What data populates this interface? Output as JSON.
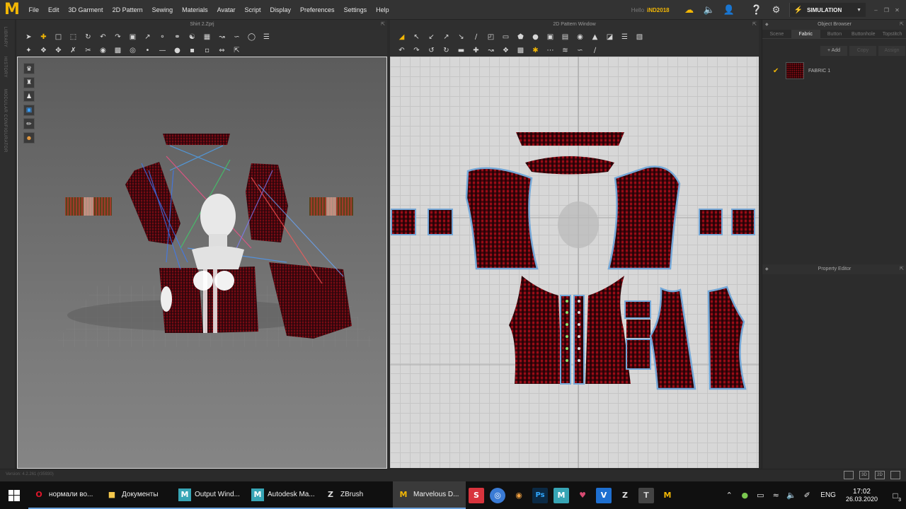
{
  "app": {
    "logo": "M",
    "menu": [
      "File",
      "Edit",
      "3D Garment",
      "2D Pattern",
      "Sewing",
      "Materials",
      "Avatar",
      "Script",
      "Display",
      "Preferences",
      "Settings",
      "Help"
    ],
    "hello_label": "Hello",
    "username": "iND2018",
    "simulation_label": "SIMULATION",
    "accent_color": "#f2b705"
  },
  "left_tabs": [
    "LIBRARY",
    "HISTORY",
    "MODULAR CONFIGURATOR"
  ],
  "viewport3d": {
    "title": "Shirt 2.Zprj"
  },
  "viewport2d": {
    "title": "2D Pattern Window"
  },
  "toolbar3d": {
    "row1": [
      "select-icon",
      "move-icon",
      "box-select-icon",
      "transform-icon",
      "rotate-icon",
      "fold-icon",
      "pin-icon",
      "pin-box-icon",
      "measure-icon",
      "tack-icon",
      "strap-icon",
      "garment-icon",
      "fit-icon",
      "tape-icon",
      "edit-curve-icon",
      "lasso-icon",
      "arrange-icon"
    ],
    "row2": [
      "avatar-icon",
      "pleat-icon",
      "zip-icon",
      "puckering-icon",
      "cut-icon",
      "button-icon",
      "graphic-icon",
      "target-icon",
      "point-icon",
      "line-icon",
      "record-icon",
      "texture-icon",
      "edit-texture-icon",
      "ruler-icon",
      "resize-icon"
    ]
  },
  "toolbar2d": {
    "row1": [
      "edit-pattern-icon",
      "edit-point-icon",
      "edit-curve-point-icon",
      "curvature-icon",
      "add-point-icon",
      "slash-icon",
      "fold-arrangement-icon",
      "rectangle-icon",
      "polygon-icon",
      "circle-icon",
      "internal-rect-icon",
      "internal-polygon-icon",
      "internal-circle-icon",
      "dart-icon",
      "trace-icon",
      "pleats-icon",
      "steps-icon"
    ],
    "row2": [
      "segment-sew-icon",
      "free-sew-icon",
      "multi-sew-icon",
      "check-sew-icon",
      "tape-2d-icon",
      "topstitch-icon",
      "fold-2d-icon",
      "buttonhole-2d-icon",
      "texture-2d-icon",
      "graphic-2d-icon",
      "pin-2d-icon",
      "gather-icon",
      "stretch-icon",
      "overlap-icon"
    ]
  },
  "viewport_tools": [
    "shirt-icon",
    "jacket-icon",
    "avatar-front-icon",
    "fabric-icon",
    "eraser-icon",
    "skin-icon"
  ],
  "object_browser": {
    "title": "Object Browser",
    "tabs": [
      "Scene",
      "Fabric",
      "Button",
      "Buttonhole",
      "Topstitch"
    ],
    "active_tab": "Fabric",
    "actions": [
      "+ Add",
      "Copy",
      "Assign"
    ],
    "fabrics": [
      {
        "name": "FABRIC 1",
        "color": "#8a0c15",
        "checked": true
      }
    ]
  },
  "property_editor": {
    "title": "Property Editor"
  },
  "status": {
    "version": "Version: 4.2.261 (r35930)"
  },
  "taskbar": {
    "tasks": [
      {
        "label": "нормали во...",
        "icon": "opera-icon",
        "color": "#e0162b"
      },
      {
        "label": "Документы",
        "icon": "folder-icon",
        "color": "#f5c84c"
      },
      {
        "label": "Output Wind...",
        "icon": "maya-icon",
        "color": "#37a5b5"
      },
      {
        "label": "Autodesk Ma...",
        "icon": "maya-icon",
        "color": "#37a5b5"
      },
      {
        "label": "ZBrush",
        "icon": "zbrush-icon",
        "color": "#dddddd"
      },
      {
        "label": "Marvelous D...",
        "icon": "marvelous-icon",
        "color": "#f2b705",
        "active": true
      }
    ],
    "pinned": [
      {
        "icon": "substance-icon",
        "color": "#d8343d"
      },
      {
        "icon": "cinema4d-icon",
        "color": "#3a7bd5"
      },
      {
        "icon": "blender-icon",
        "color": "#f0a040"
      },
      {
        "icon": "photoshop-icon",
        "color": "#2c8ad8"
      },
      {
        "icon": "maya-icon",
        "color": "#37a5b5"
      },
      {
        "icon": "heart-app-icon",
        "color": "#d84a72"
      },
      {
        "icon": "vray-icon",
        "color": "#1e6fd0"
      },
      {
        "icon": "zbrush-icon",
        "color": "#dddddd"
      },
      {
        "icon": "topogun-icon",
        "color": "#cccccc"
      },
      {
        "icon": "marvelous-icon",
        "color": "#f2b705"
      }
    ],
    "tray": {
      "lang": "ENG",
      "time": "17:02",
      "date": "26.03.2020",
      "notifications": "3"
    }
  }
}
